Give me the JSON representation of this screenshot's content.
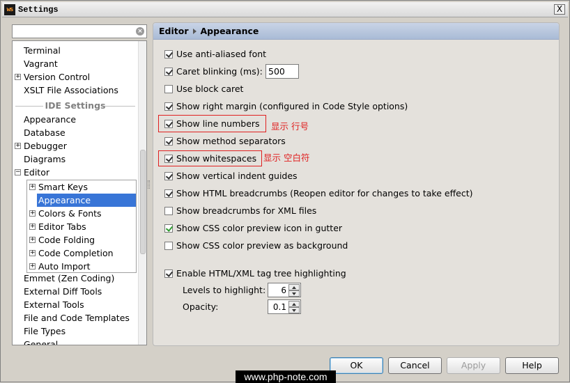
{
  "window": {
    "title": "Settings",
    "close_label": "X",
    "app_icon_text": "ws"
  },
  "search": {
    "value": "",
    "placeholder": "",
    "clear_glyph": "×"
  },
  "tree": {
    "items_top": [
      {
        "label": "Terminal"
      },
      {
        "label": "Vagrant"
      },
      {
        "label": "Version Control",
        "expander": "+"
      },
      {
        "label": "XSLT File Associations"
      }
    ],
    "group_label": "IDE Settings",
    "items_ide": [
      {
        "label": "Appearance"
      },
      {
        "label": "Database"
      },
      {
        "label": "Debugger",
        "expander": "+"
      },
      {
        "label": "Diagrams"
      },
      {
        "label": "Editor",
        "expander": "−"
      }
    ],
    "editor_children": [
      {
        "label": "Smart Keys",
        "expander": "+"
      },
      {
        "label": "Appearance",
        "selected": true
      },
      {
        "label": "Colors & Fonts",
        "expander": "+"
      },
      {
        "label": "Editor Tabs",
        "expander": "+"
      },
      {
        "label": "Code Folding",
        "expander": "+"
      },
      {
        "label": "Code Completion",
        "expander": "+"
      },
      {
        "label": "Auto Import",
        "expander": "+"
      }
    ],
    "items_bottom": [
      {
        "label": "Emmet (Zen Coding)"
      },
      {
        "label": "External Diff Tools"
      },
      {
        "label": "External Tools"
      },
      {
        "label": "File and Code Templates"
      },
      {
        "label": "File Types"
      },
      {
        "label": "General"
      }
    ]
  },
  "header": {
    "crumb_1": "Editor",
    "crumb_2": "Appearance"
  },
  "options": [
    {
      "label": "Use anti-aliased font",
      "checked": true
    },
    {
      "label": "Caret blinking (ms):",
      "checked": true
    },
    {
      "label": "Use block caret",
      "checked": false
    },
    {
      "label": "Show right margin (configured in Code Style options)",
      "checked": true
    },
    {
      "label": "Show line numbers",
      "checked": true
    },
    {
      "label": "Show method separators",
      "checked": true
    },
    {
      "label": "Show whitespaces",
      "checked": true
    },
    {
      "label": "Show vertical indent guides",
      "checked": true
    },
    {
      "label": "Show HTML breadcrumbs (Reopen editor for changes to take effect)",
      "checked": true
    },
    {
      "label": "Show breadcrumbs for XML files",
      "checked": false
    },
    {
      "label": "Show CSS color preview icon in gutter",
      "checked": true,
      "green": true
    },
    {
      "label": "Show CSS color preview as background",
      "checked": false
    },
    {
      "label": "Enable HTML/XML tag tree highlighting",
      "checked": true
    }
  ],
  "caret_blink_value": "500",
  "levels_label": "Levels to highlight:",
  "levels_value": "6",
  "opacity_label": "Opacity:",
  "opacity_value": "0.1",
  "annotations": {
    "line_numbers": "显示 行号",
    "whitespaces": "显示 空白符",
    "color": "#e02020"
  },
  "buttons": {
    "ok": "OK",
    "cancel": "Cancel",
    "apply": "Apply",
    "help": "Help"
  },
  "watermark": "www.php-note.com"
}
